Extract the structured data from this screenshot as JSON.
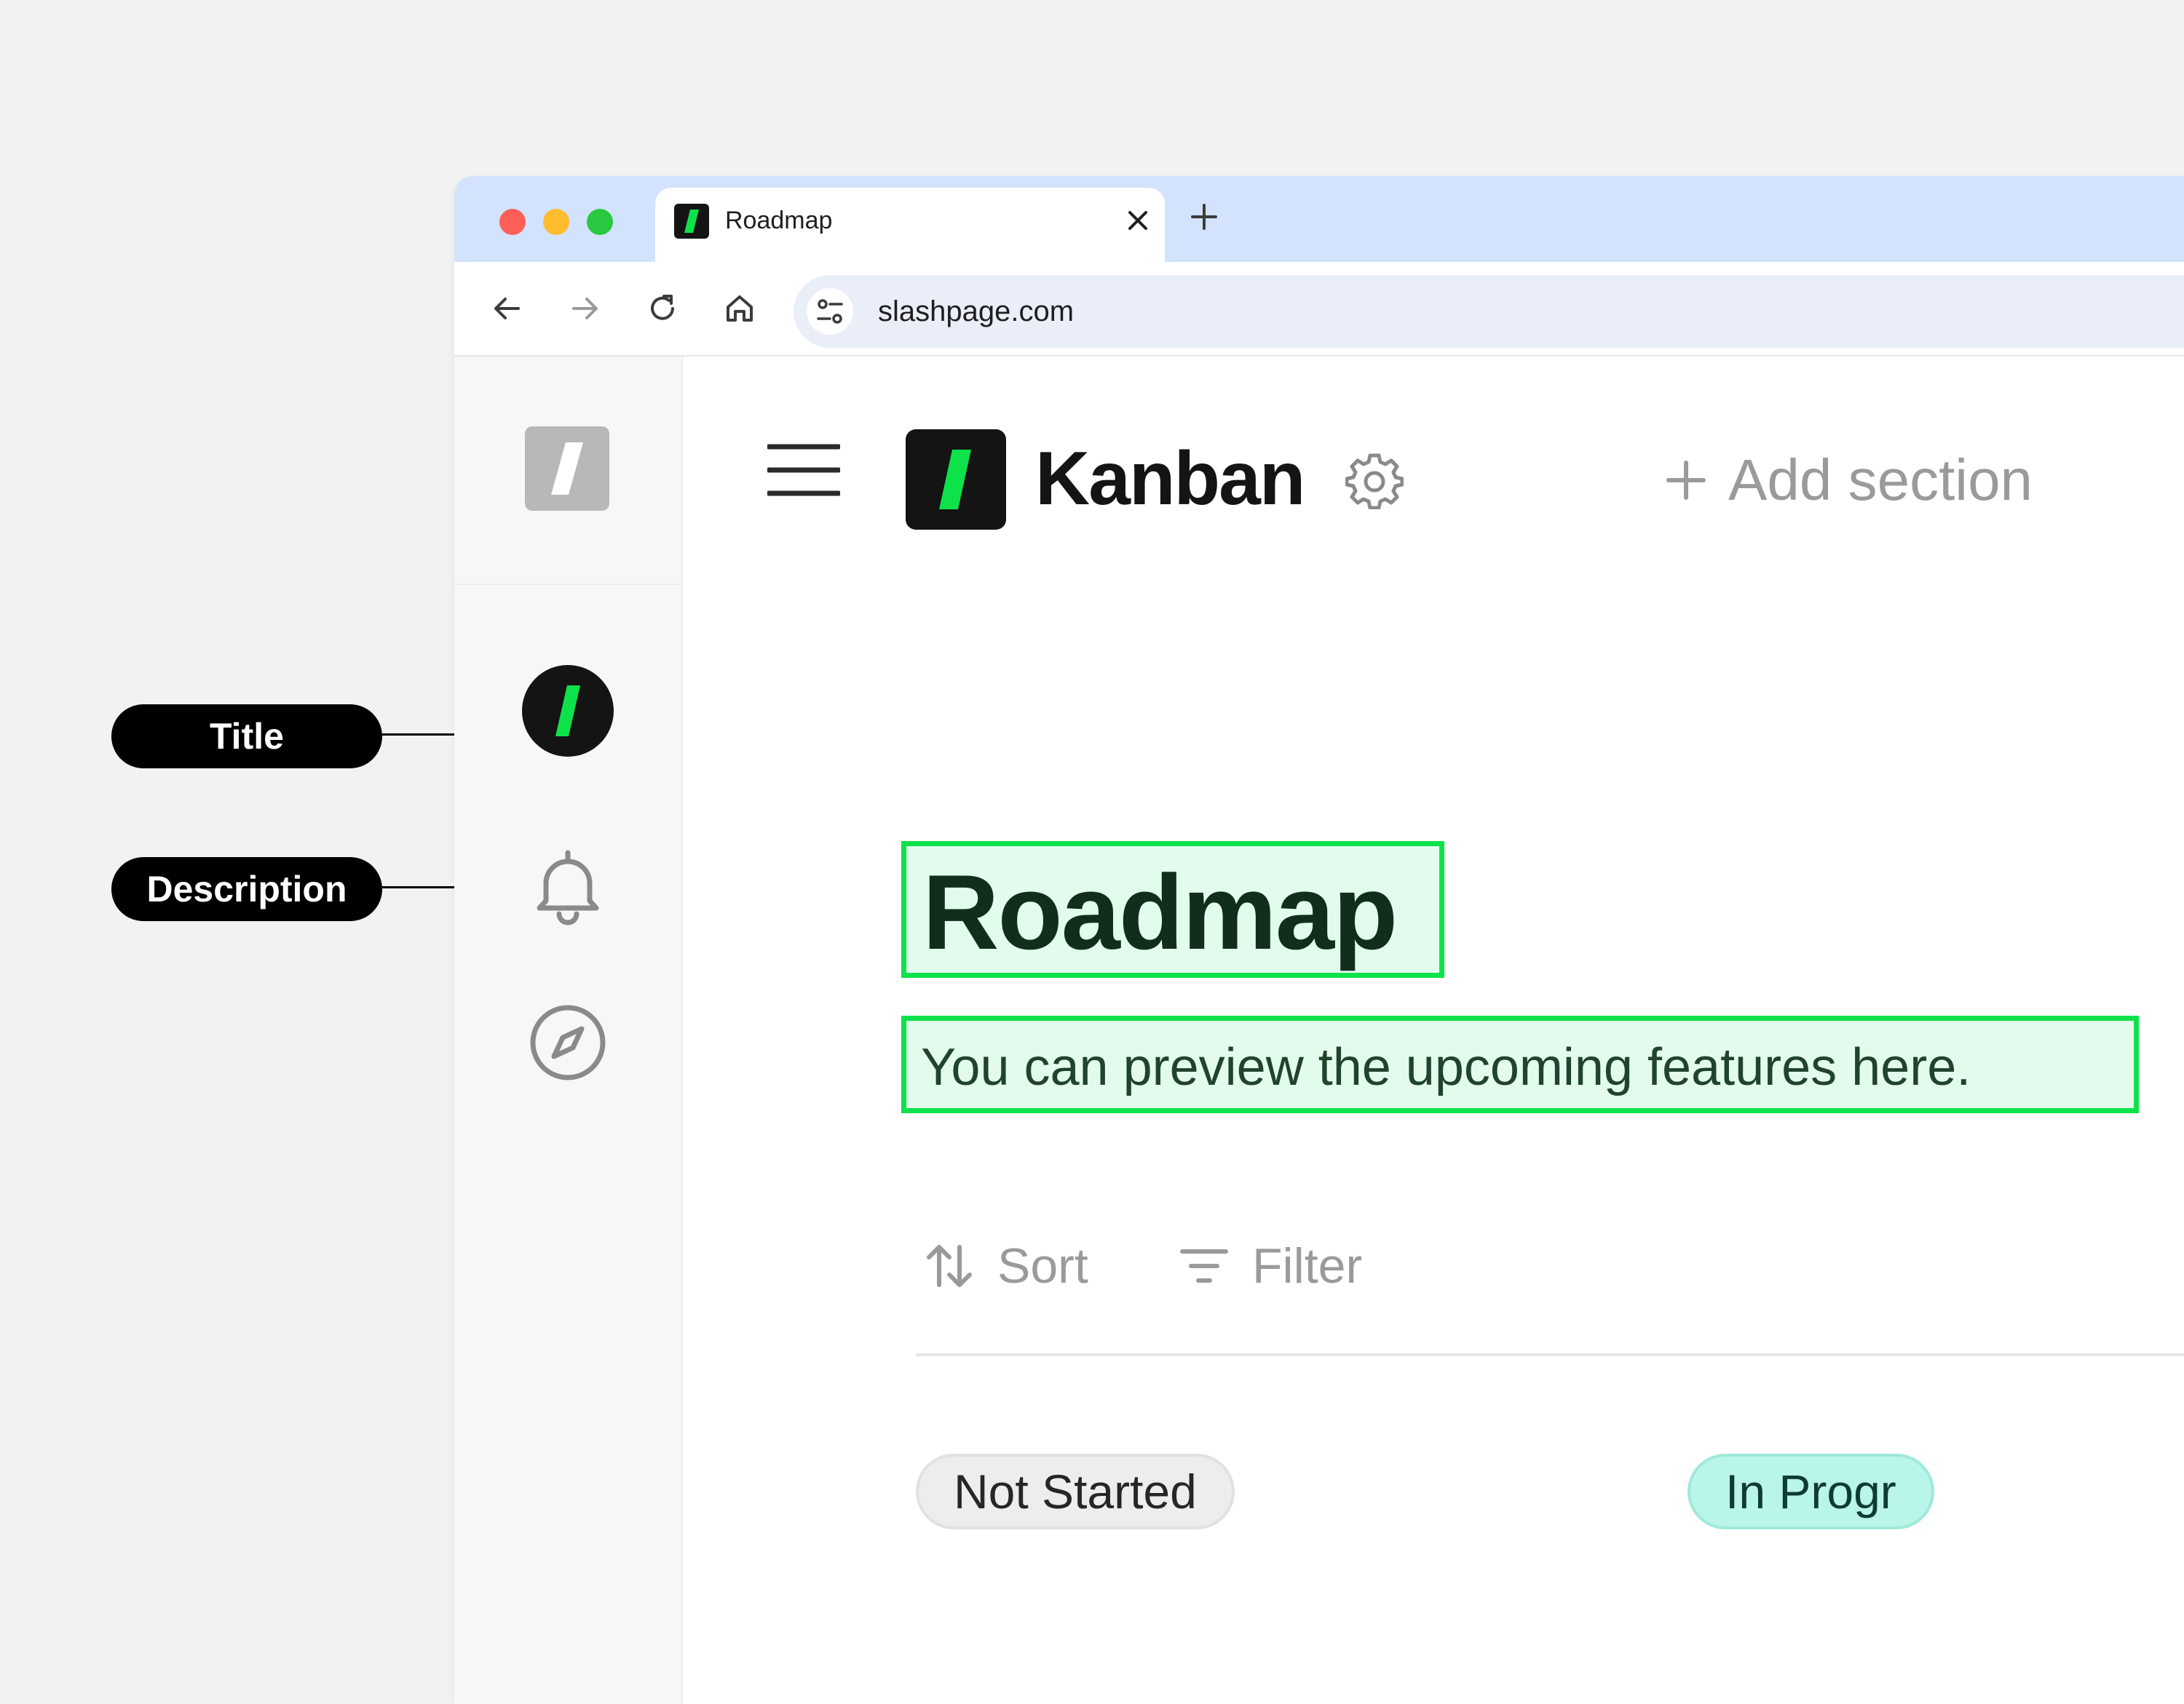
{
  "annotations": {
    "title_label": "Title",
    "description_label": "Description"
  },
  "browser": {
    "tab": {
      "title": "Roadmap"
    },
    "address_bar": {
      "url": "slashpage.com"
    }
  },
  "header": {
    "section_title": "Kanban",
    "add_section_label": "Add section"
  },
  "page": {
    "title": "Roadmap",
    "description": "You can preview the upcoming features here."
  },
  "toolbar": {
    "sort_label": "Sort",
    "filter_label": "Filter"
  },
  "columns": [
    {
      "label": "Not Started"
    },
    {
      "label": "In Progr"
    }
  ],
  "icons": {
    "traffic_lights": [
      "close-light",
      "minimize-light",
      "maximize-light"
    ],
    "nav": [
      "back-arrow-icon",
      "forward-arrow-icon",
      "reload-icon",
      "home-icon"
    ],
    "sidebar": [
      "workspace-logo-icon",
      "slashpage-avatar-icon",
      "bell-icon",
      "compass-icon"
    ]
  },
  "colors": {
    "titlebar": "#d3e3fd",
    "traffic_red": "#ff5f57",
    "traffic_yellow": "#febc2e",
    "traffic_green": "#28c840",
    "brand_green": "#0ee24a",
    "highlight_fill": "#e3fbec",
    "in_progress_pill": "#b9f5e8"
  }
}
